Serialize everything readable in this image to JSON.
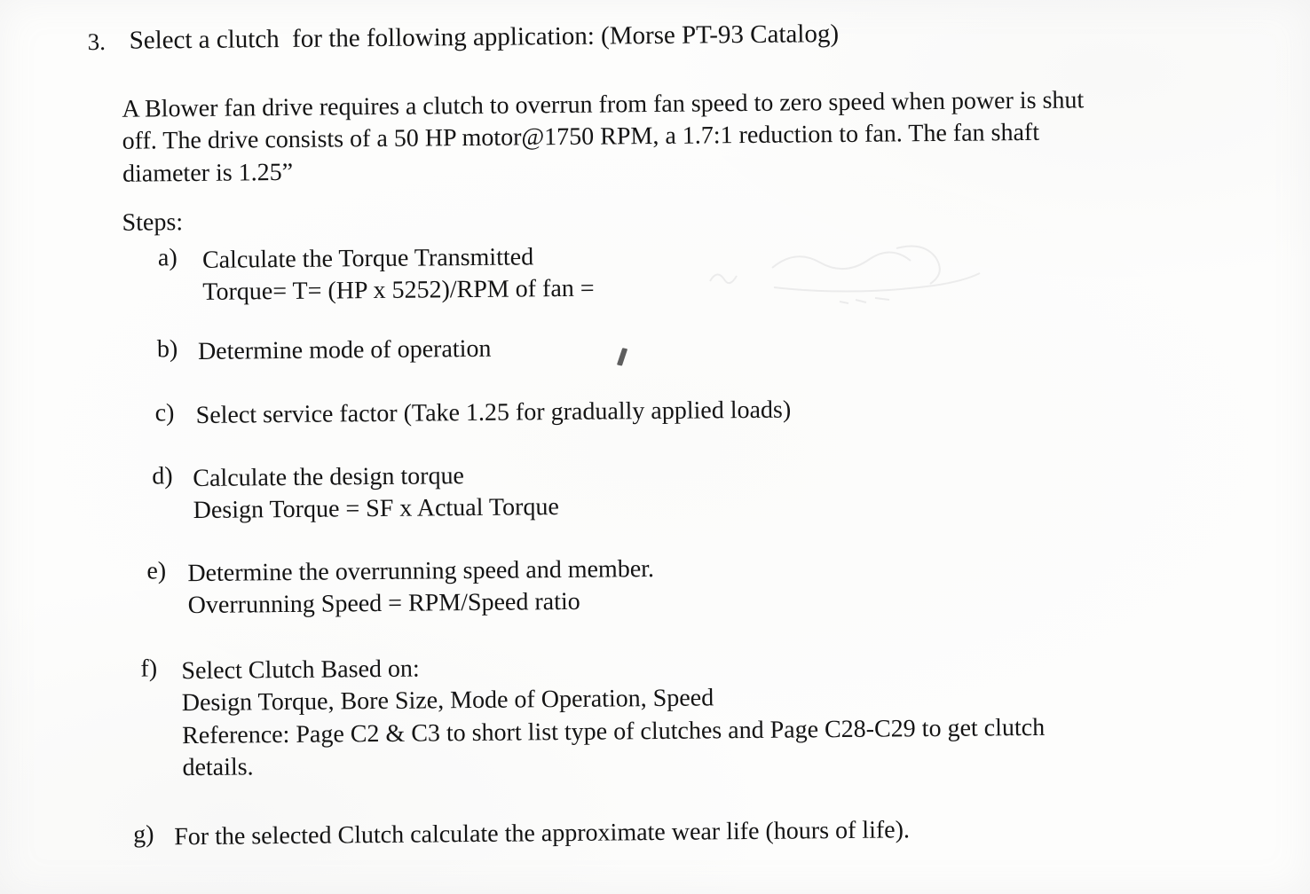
{
  "document": {
    "type": "scanned-assignment-page",
    "background_color": "#fdfdfc",
    "text_color": "#141414",
    "problem_number": "3.",
    "title": "Select a clutch  for the following application: (Morse PT-93 Catalog)",
    "problem_statement": {
      "line1": "A Blower fan drive requires a clutch to overrun from fan speed to zero speed when power is shut",
      "line2": "off. The drive consists of a 50 HP motor@1750 RPM, a 1.7:1 reduction to fan. The fan shaft",
      "line3": "diameter is 1.25”"
    },
    "steps_label": "Steps:",
    "steps": [
      {
        "marker": "a)",
        "lines": [
          "Calculate the Torque Transmitted",
          "Torque= T= (HP x 5252)/RPM of fan ="
        ]
      },
      {
        "marker": "b)",
        "lines": [
          "Determine mode of operation"
        ]
      },
      {
        "marker": "c)",
        "lines": [
          "Select service factor (Take 1.25 for gradually applied loads)"
        ]
      },
      {
        "marker": "d)",
        "lines": [
          "Calculate the design torque",
          "Design Torque = SF x Actual Torque"
        ]
      },
      {
        "marker": "e)",
        "lines": [
          "Determine the overrunning speed and member.",
          "Overrunning Speed = RPM/Speed ratio"
        ]
      },
      {
        "marker": "f)",
        "lines": [
          "Select Clutch Based on:",
          "Design Torque, Bore Size, Mode of Operation, Speed",
          "Reference:  Page C2 & C3 to short list type of clutches and Page C28-C29 to get clutch",
          "details."
        ]
      },
      {
        "marker": "g)",
        "lines": [
          "For the selected Clutch calculate the approximate wear life (hours of life)."
        ]
      }
    ],
    "artifacts": {
      "stray_pen_mark": "small slanted ink tick right of step b",
      "erased_pencil_ghost": "faint erased handwriting above step a equation"
    }
  }
}
